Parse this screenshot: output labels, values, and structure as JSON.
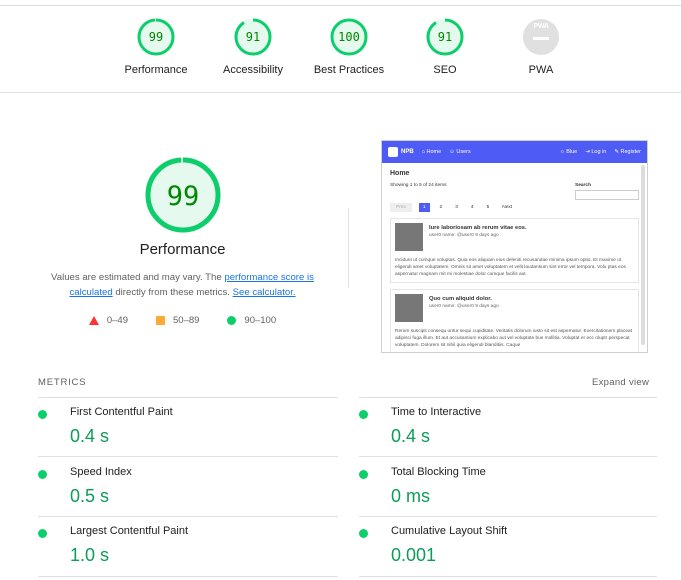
{
  "summary": {
    "gauges": [
      {
        "label": "Performance",
        "score": "99"
      },
      {
        "label": "Accessibility",
        "score": "91"
      },
      {
        "label": "Best Practices",
        "score": "100"
      },
      {
        "label": "SEO",
        "score": "91"
      },
      {
        "label": "PWA",
        "score": "",
        "icon": "pwa-icon",
        "icon_text": "PWA"
      }
    ],
    "colors": {
      "pass": "#0cce6b",
      "pass_text": "#008800",
      "pass_bg": "#e6f9ee",
      "na": "#e0e0e0"
    }
  },
  "performance": {
    "score": "99",
    "title": "Performance",
    "desc_prefix": "Values are estimated and may vary. The ",
    "desc_link1": "performance score is calculated",
    "desc_middle": " directly from these metrics. ",
    "desc_link2": "See calculator.",
    "legend": [
      {
        "range": "0–49",
        "shape": "triangle",
        "color": "#ff3333"
      },
      {
        "range": "50–89",
        "shape": "square",
        "color": "#ffaa33"
      },
      {
        "range": "90–100",
        "shape": "circle",
        "color": "#0cce6b"
      }
    ]
  },
  "screenshot": {
    "brand": "NPB",
    "nav_home": "Home",
    "nav_users": "Users",
    "nav_blue": "Blue",
    "nav_login": "Log in",
    "nav_register": "Register",
    "page_heading": "Home",
    "showing_text": "Showing 1 to 5 of 24 items",
    "search_label": "Search",
    "pagination": [
      "Prev",
      "1",
      "2",
      "3",
      "4",
      "5",
      "Next"
    ],
    "posts": [
      {
        "title": "Iure laboriosam ab rerum vitae eos.",
        "meta": "user0 name: @user0 9 days ago",
        "body": "Incidunt ut cumque voluptas. Quia eos aliquam eius deleniti recusandae minima ipsum optio. Et maxime ut eligendi amet voluptatem. Omnis sit amet voluptatem et velit laudantium sint error vel tempora. Volu ptas eos aspernatur magnam mit mi molestiae dolor cumque facilis aut."
      },
      {
        "title": "Quo cum aliquid dolor.",
        "meta": "user0 name: @user0 9 days ago",
        "body": "Rerum suscipit consequ untur sequi cupiditate. Veritatis dolorum iusto sit est aspernatur. Exercitationem placeat adipisci fuga illum. Et aut accusantium explicabo aut vel voluptate bus mollitia. Voluptat er ecc oluptr perspecat voluptatem. Dolorem sit nihil quia eligendi blanditiis. Caque"
      }
    ]
  },
  "metrics": {
    "heading": "METRICS",
    "expand_label": "Expand view",
    "items": [
      {
        "name": "First Contentful Paint",
        "value": "0.4 s"
      },
      {
        "name": "Time to Interactive",
        "value": "0.4 s"
      },
      {
        "name": "Speed Index",
        "value": "0.5 s"
      },
      {
        "name": "Total Blocking Time",
        "value": "0 ms"
      },
      {
        "name": "Largest Contentful Paint",
        "value": "1.0 s"
      },
      {
        "name": "Cumulative Layout Shift",
        "value": "0.001"
      }
    ]
  }
}
